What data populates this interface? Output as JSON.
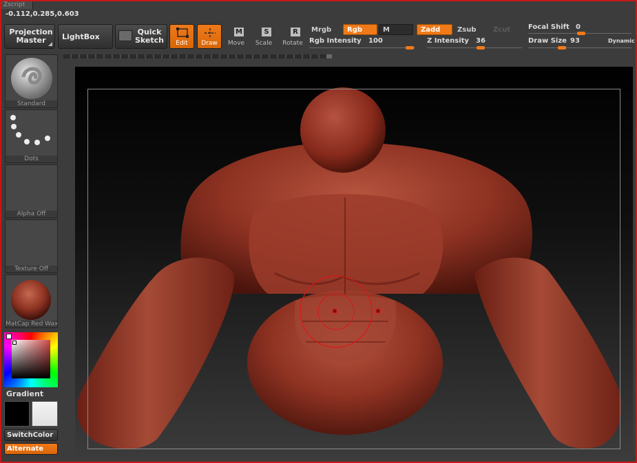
{
  "zscript_tab": "Zscript",
  "coordinates": "-0.112,0.285,0.603",
  "toolbar": {
    "projection_master": "Projection Master",
    "lightbox": "LightBox",
    "quick_sketch": "Quick Sketch",
    "edit": "Edit",
    "draw": "Draw",
    "move": "Move",
    "scale": "Scale",
    "rotate": "Rotate",
    "move_key": "M",
    "scale_key": "S",
    "rotate_key": "R",
    "mrgb": "Mrgb",
    "rgb": "Rgb",
    "m": "M",
    "zadd": "Zadd",
    "zsub": "Zsub",
    "zcut": "Zcut",
    "rgb_intensity_label": "Rgb Intensity",
    "rgb_intensity_value": "100",
    "z_intensity_label": "Z Intensity",
    "z_intensity_value": "36",
    "focal_shift_label": "Focal Shift",
    "focal_shift_value": "0",
    "draw_size_label": "Draw Size",
    "draw_size_value": "93",
    "dynamic": "Dynamic"
  },
  "left_shelf": {
    "brush_label": "Standard",
    "stroke_label": "Dots",
    "alpha_label": "Alpha Off",
    "texture_label": "Texture Off",
    "material_label": "MatCap Red Wax",
    "gradient_label": "Gradient",
    "switchcolor_label": "SwitchColor",
    "alternate_label": "Alternate"
  },
  "colors": {
    "accent": "#f07a1a",
    "model": "#8c2e20",
    "border": "#c81818"
  }
}
